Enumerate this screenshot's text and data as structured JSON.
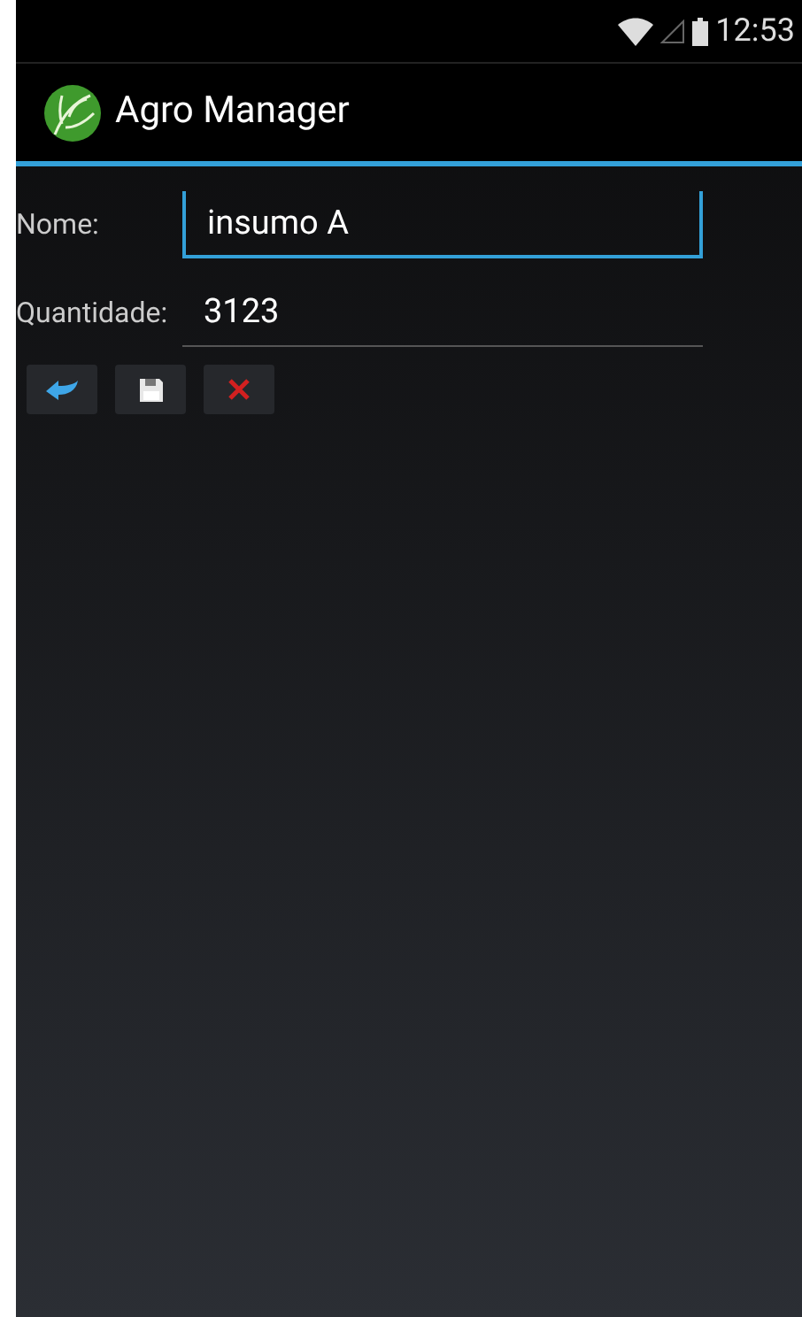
{
  "status_bar": {
    "time": "12:53"
  },
  "action_bar": {
    "title": "Agro Manager"
  },
  "fields": [
    {
      "label": "Nome:",
      "value": "insumo A",
      "focused": true
    },
    {
      "label": "Quantidade:",
      "value": "3123",
      "focused": false
    }
  ],
  "buttons": [
    {
      "kind": "back"
    },
    {
      "kind": "save"
    },
    {
      "kind": "delete"
    }
  ]
}
